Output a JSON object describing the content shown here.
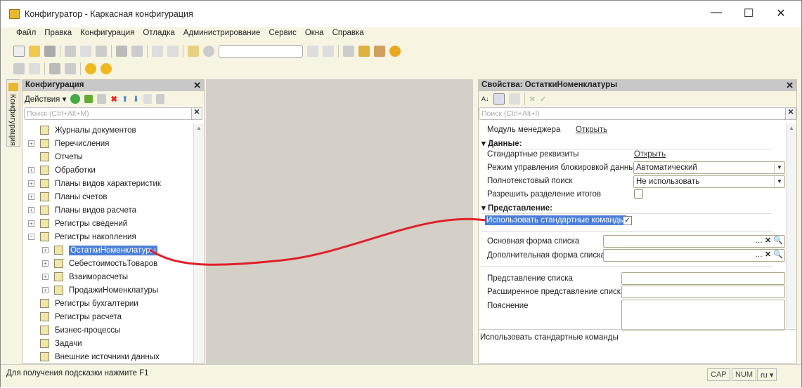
{
  "window": {
    "title": "Конфигуратор - Каркасная конфигурация",
    "minimize": "—",
    "maximize": "☐",
    "close": "✕"
  },
  "menu": [
    "Файл",
    "Правка",
    "Конфигурация",
    "Отладка",
    "Администрирование",
    "Сервис",
    "Окна",
    "Справка"
  ],
  "side_tab": "Конфигурация",
  "config_panel": {
    "title": "Конфигурация",
    "actions": "Действия ▾",
    "search_placeholder": "Поиск (Ctrl+Alt+M)",
    "tree": [
      {
        "label": "Журналы документов",
        "expand": false,
        "level": 0
      },
      {
        "label": "Перечисления",
        "expand": true,
        "level": 0
      },
      {
        "label": "Отчеты",
        "expand": false,
        "level": 0
      },
      {
        "label": "Обработки",
        "expand": true,
        "level": 0
      },
      {
        "label": "Планы видов характеристик",
        "expand": true,
        "level": 0
      },
      {
        "label": "Планы счетов",
        "expand": true,
        "level": 0
      },
      {
        "label": "Планы видов расчета",
        "expand": true,
        "level": 0
      },
      {
        "label": "Регистры сведений",
        "expand": true,
        "level": 0
      },
      {
        "label": "Регистры накопления",
        "expand": true,
        "expanded": true,
        "level": 0
      },
      {
        "label": "ОстаткиНоменклатуры",
        "expand": true,
        "level": 1,
        "selected": true
      },
      {
        "label": "СебестоимостьТоваров",
        "expand": true,
        "level": 1
      },
      {
        "label": "Взаиморасчеты",
        "expand": true,
        "level": 1
      },
      {
        "label": "ПродажиНоменклатуры",
        "expand": true,
        "level": 1
      },
      {
        "label": "Регистры бухгалтерии",
        "expand": false,
        "level": 0
      },
      {
        "label": "Регистры расчета",
        "expand": false,
        "level": 0
      },
      {
        "label": "Бизнес-процессы",
        "expand": false,
        "level": 0
      },
      {
        "label": "Задачи",
        "expand": false,
        "level": 0
      },
      {
        "label": "Внешние источники данных",
        "expand": false,
        "level": 0
      }
    ]
  },
  "props_panel": {
    "title": "Свойства: ОстаткиНоменклатуры",
    "search_placeholder": "Поиск (Ctrl+Alt+I)",
    "manager_module": "Модуль менеджера",
    "open": "Открыть",
    "section_data": "Данные:",
    "std_attrs": "Стандартные реквизиты",
    "lock_mode": "Режим управления блокировкой данных",
    "lock_mode_value": "Автоматический",
    "fulltext": "Полнотекстовый поиск",
    "fulltext_value": "Не использовать",
    "split_totals": "Разрешить разделение итогов",
    "split_totals_checked": false,
    "section_view": "Представление:",
    "use_std_cmds": "Использовать стандартные команды",
    "use_std_cmds_checked": true,
    "main_list_form": "Основная форма списка",
    "extra_list_form": "Дополнительная форма списка",
    "list_presentation": "Представление списка",
    "ext_list_presentation": "Расширенное представление списка",
    "explanation": "Пояснение",
    "hint": "Использовать стандартные команды"
  },
  "status": {
    "hint": "Для получения подсказки нажмите F1",
    "cap": "CAP",
    "num": "NUM",
    "lang": "ru ▾"
  },
  "colors": {
    "background": "#f7f4e2",
    "selection": "#4a7fd8",
    "annotation": "#e0202a"
  }
}
